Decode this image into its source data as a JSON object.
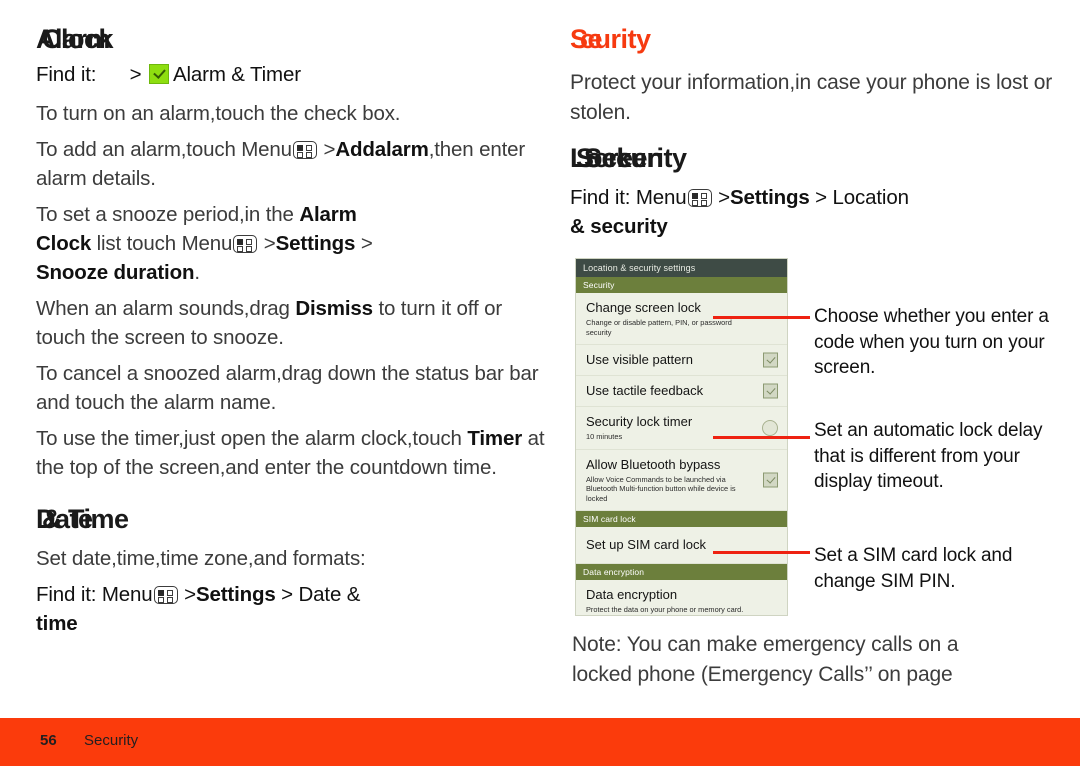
{
  "document": {
    "footer": {
      "page_number": "56",
      "section": "Security"
    },
    "accent_color": "#fb3b0c",
    "callout_line_color": "#ee2211"
  },
  "left_column": {
    "heading": {
      "part_a": "Alarm",
      "part_b": "Clock"
    },
    "find_it": {
      "label": "Find it:",
      "separator": ">",
      "icon": "green-check-icon",
      "target": "Alarm & Timer"
    },
    "paragraphs": [
      {
        "id": "turn-on-alarm",
        "runs": [
          {
            "text": "To turn on an alarm,touch the check box.",
            "style": "normal"
          }
        ]
      },
      {
        "id": "add-alarm",
        "runs": [
          {
            "text": "To add an alarm,touch Menu",
            "style": "normal"
          },
          {
            "text": "menu-icon",
            "style": "icon"
          },
          {
            "text": " >",
            "style": "normal"
          },
          {
            "text": "Add",
            "style": "bold"
          },
          {
            "text": "alarm",
            "style": "bold"
          },
          {
            "text": ",then enter alarm details.",
            "style": "normal"
          }
        ]
      },
      {
        "id": "snooze-period",
        "runs": [
          {
            "text": "To set a snooze period,in the ",
            "style": "normal"
          },
          {
            "text": "Alarm",
            "style": "bold"
          },
          {
            "text": "Clock",
            "style": "bold"
          },
          {
            "text": " list touch Menu",
            "style": "normal"
          },
          {
            "text": "menu-icon",
            "style": "icon"
          },
          {
            "text": " >",
            "style": "normal"
          },
          {
            "text": "Settings",
            "style": "bold"
          },
          {
            "text": " > ",
            "style": "normal"
          },
          {
            "text": "Snooze duration",
            "style": "bold"
          },
          {
            "text": ".",
            "style": "normal"
          }
        ]
      },
      {
        "id": "alarm-sounds",
        "runs": [
          {
            "text": "When an alarm sounds,drag ",
            "style": "normal"
          },
          {
            "text": "Dismiss",
            "style": "bold"
          },
          {
            "text": " to turn it off or touch the screen to snooze.",
            "style": "normal"
          }
        ]
      },
      {
        "id": "cancel-snoozed",
        "runs": [
          {
            "text": "To cancel a snoozed alarm,drag down the status bar bar and touch the alarm name.",
            "style": "normal"
          }
        ]
      },
      {
        "id": "use-timer",
        "runs": [
          {
            "text": "To use the timer,just open the alarm clock,touch ",
            "style": "normal"
          },
          {
            "text": "Timer",
            "style": "bold"
          },
          {
            "text": " at the top of the screen,and enter the countdown time.",
            "style": "normal"
          }
        ]
      }
    ],
    "date_time_section": {
      "heading": {
        "part_a": "Date",
        "part_b": "& Time"
      },
      "intro": "Set date,time,time zone,and formats:",
      "find_it": {
        "label": "Find it:",
        "menu_word": "Menu",
        "icon": "menu-icon",
        "path_1": ">",
        "path_2": "Settings",
        "path_3": "> Date &",
        "path_4": "time"
      }
    }
  },
  "right_column": {
    "heading": {
      "part_a": "Se",
      "part_b": "curity"
    },
    "intro": "Protect your information,in case your phone is lost or stolen.",
    "lock_screen_section": {
      "heading": {
        "part_a": "Lock",
        "part_b": "Screen",
        "part_c": "Security"
      },
      "find_it": {
        "label": "Find it:",
        "menu_word": "Menu",
        "icon": "menu-icon",
        "path_1": ">",
        "path_2": "Settings",
        "path_3": "> Location",
        "path_4": "& security"
      }
    },
    "note": "Note: You can make emergency calls on a locked phone (Emergency Calls” on page"
  },
  "phone_screenshot": {
    "title_bar": "Location & security settings",
    "sections": [
      {
        "header": "Security",
        "rows": [
          {
            "title": "Change screen lock",
            "subtitle": "Change or disable pattern, PIN, or password security",
            "control": "none"
          },
          {
            "title": "Use visible pattern",
            "subtitle": "",
            "control": "checkbox-checked"
          },
          {
            "title": "Use tactile feedback",
            "subtitle": "",
            "control": "checkbox-checked"
          },
          {
            "title": "Security lock timer",
            "subtitle": "10 minutes",
            "control": "radio"
          },
          {
            "title": "Allow Bluetooth bypass",
            "subtitle": "Allow Voice Commands to be launched via Bluetooth Multi-function button while device is locked",
            "control": "checkbox-checked"
          }
        ]
      },
      {
        "header": "SIM card lock",
        "rows": [
          {
            "title": "Set up SIM card lock",
            "subtitle": "",
            "control": "none"
          }
        ]
      },
      {
        "header": "Data encryption",
        "rows": [
          {
            "title": "Data encryption",
            "subtitle": "Protect the data on your phone or memory card. Requires screen lock",
            "control": "none"
          }
        ]
      }
    ]
  },
  "callouts": [
    {
      "id": "callout-1",
      "text": "Choose whether you enter a code when you turn on your screen."
    },
    {
      "id": "callout-2",
      "text": "Set an automatic lock delay that is different from your display timeout."
    },
    {
      "id": "callout-3",
      "text": "Set a SIM card lock and change SIM PIN."
    }
  ]
}
